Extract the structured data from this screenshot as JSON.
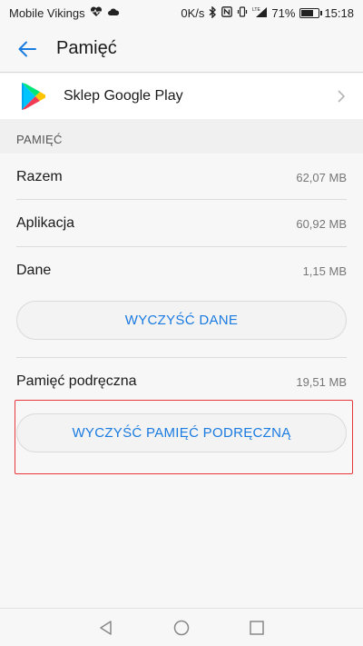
{
  "status_bar": {
    "carrier": "Mobile Vikings",
    "speed": "0K/s",
    "battery": "71%",
    "battery_level": 0.71,
    "time": "15:18",
    "network_label": "LTE"
  },
  "app_bar": {
    "title": "Pamięć"
  },
  "app": {
    "name": "Sklep Google Play"
  },
  "section": {
    "title": "PAMIĘĆ"
  },
  "storage": {
    "rows": [
      {
        "label": "Razem",
        "value": "62,07 MB"
      },
      {
        "label": "Aplikacja",
        "value": "60,92 MB"
      },
      {
        "label": "Dane",
        "value": "1,15 MB"
      }
    ],
    "clear_data_label": "WYCZYŚĆ DANE",
    "cache_label": "Pamięć podręczna",
    "cache_value": "19,51 MB",
    "clear_cache_label": "WYCZYŚĆ PAMIĘĆ PODRĘCZNĄ"
  },
  "colors": {
    "accent": "#1a7be0",
    "highlight": "#e8373a"
  }
}
